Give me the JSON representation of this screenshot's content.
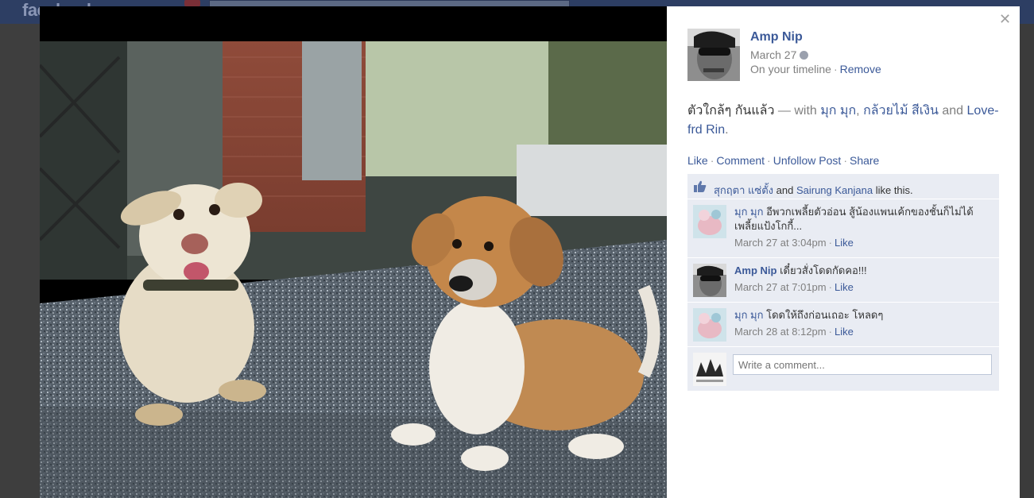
{
  "topbar": {
    "logo": "facebook"
  },
  "post": {
    "author": "Amp Nip",
    "date": "March 27",
    "timeline_text": "On your timeline",
    "remove_label": "Remove",
    "caption_text": "ตัวใกล้ๆ กันแล้ว",
    "caption_with": " — with ",
    "tagged": [
      "มุก มุก",
      "กล้วยไม้ สีเงิน",
      "Love-frd Rin"
    ],
    "caption_comma": ", ",
    "caption_and": " and",
    "caption_end": "."
  },
  "actions": [
    "Like",
    "Comment",
    "Unfollow Post",
    "Share"
  ],
  "likes": {
    "user1": "สุกฤตา แซ่ตั้ง",
    "and": " and ",
    "user2": "Sairung Kanjana",
    "suffix": " like this."
  },
  "comments": [
    {
      "name": "มุก มุก",
      "text": " อีพวกเพลี้ยตัวอ่อน สู้น้องแพนเค้กของชั้นก็ไม่ได้ เพลี้ยแป้งโกกี้...",
      "time": "March 27 at 3:04pm",
      "like": "Like"
    },
    {
      "name": "Amp Nip",
      "text": " เดี๋ยวสั่งโดดกัดคอ!!!",
      "time": "March 27 at 7:01pm",
      "like": "Like"
    },
    {
      "name": "มุก มุก",
      "text": " โดดให้ถึงก่อนเถอะ โหลดๆ",
      "time": "March 28 at 8:12pm",
      "like": "Like"
    }
  ],
  "comment_box": {
    "placeholder": "Write a comment..."
  },
  "colors": {
    "link": "#3b5998",
    "ufi_bg": "#e9ecf3"
  }
}
